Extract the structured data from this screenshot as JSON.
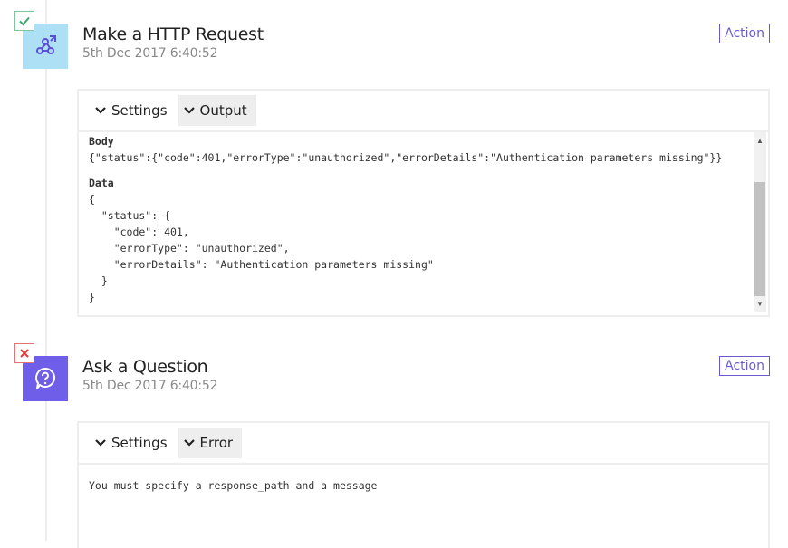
{
  "steps": [
    {
      "status": "success",
      "title": "Make a HTTP Request",
      "timestamp": "5th Dec 2017 6:40:52",
      "badge": "Action",
      "icon": "webhook-icon",
      "tabs": [
        "Settings",
        "Output"
      ],
      "active_tab": "Output",
      "output": {
        "body_label": "Body",
        "body_value": "{\"status\":{\"code\":401,\"errorType\":\"unauthorized\",\"errorDetails\":\"Authentication parameters missing\"}}",
        "data_label": "Data",
        "data_lines": [
          "{",
          "  \"status\": {",
          "    \"code\": 401,",
          "    \"errorType\": \"unauthorized\",",
          "    \"errorDetails\": \"Authentication parameters missing\"",
          "  }",
          "}"
        ]
      }
    },
    {
      "status": "fail",
      "title": "Ask a Question",
      "timestamp": "5th Dec 2017 6:40:52",
      "badge": "Action",
      "icon": "question-bubble-icon",
      "tabs": [
        "Settings",
        "Error"
      ],
      "active_tab": "Error",
      "error_message": "You must specify a response_path and a message"
    }
  ],
  "colors": {
    "accent": "#6a5acd",
    "success": "#3aa76d",
    "fail": "#e53935",
    "http_icon_bg": "#aee0f5",
    "question_icon_bg": "#6f5ee8"
  }
}
